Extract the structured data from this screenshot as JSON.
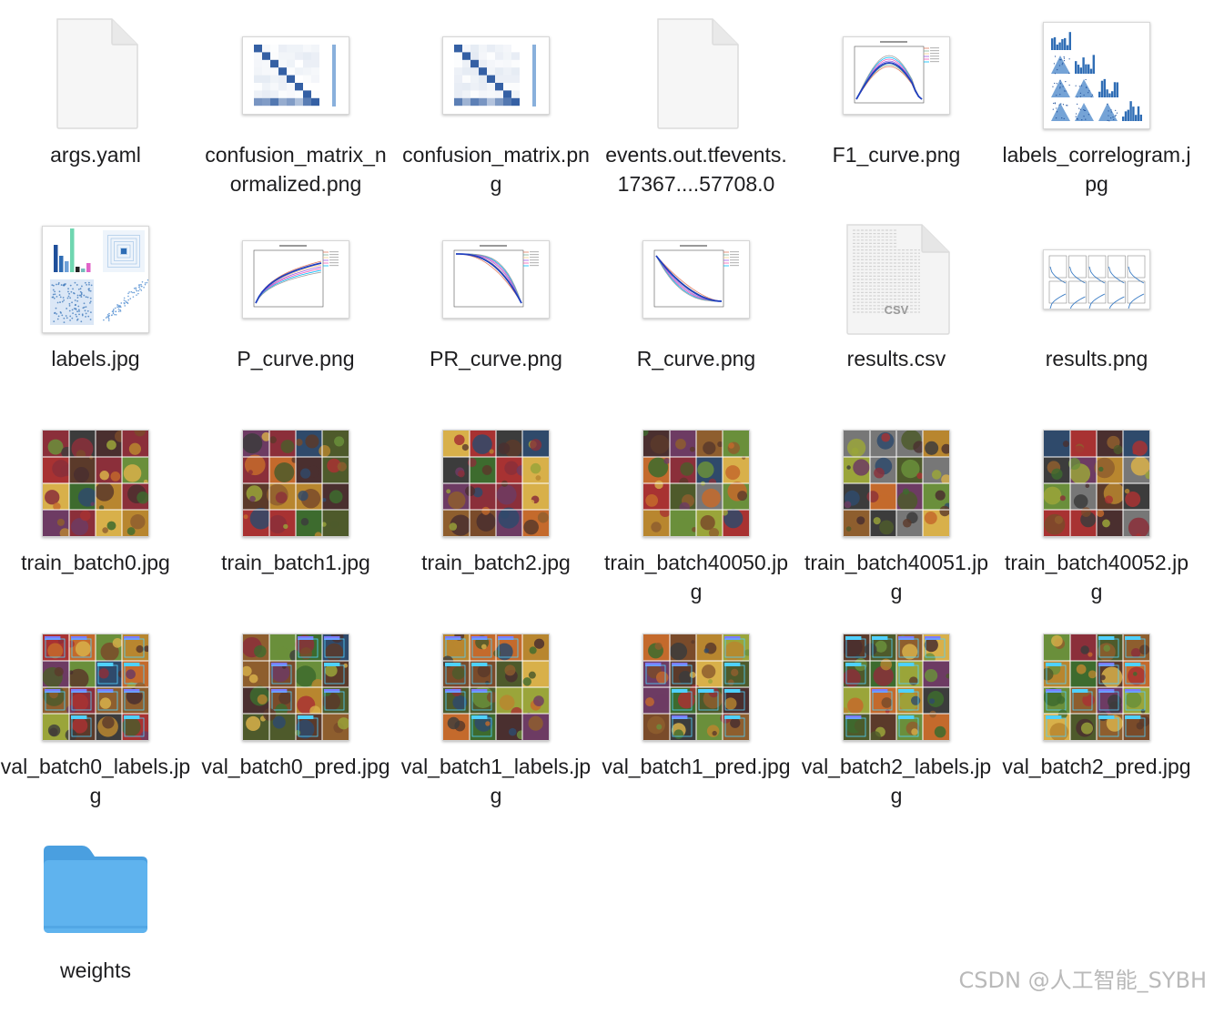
{
  "files": [
    {
      "name": "args.yaml",
      "kind": "document",
      "icon": "generic-document-icon"
    },
    {
      "name": "confusion_matrix_normalized.png",
      "kind": "confusion",
      "icon": "confusion-matrix-thumbnail"
    },
    {
      "name": "confusion_matrix.png",
      "kind": "confusion",
      "icon": "confusion-matrix-thumbnail"
    },
    {
      "name": "events.out.tfevents.17367....57708.0",
      "kind": "document",
      "icon": "generic-document-icon"
    },
    {
      "name": "F1_curve.png",
      "kind": "curve",
      "icon": "f1-curve-thumbnail"
    },
    {
      "name": "labels_correlogram.jpg",
      "kind": "correlogram",
      "icon": "correlogram-thumbnail"
    },
    {
      "name": "labels.jpg",
      "kind": "labels",
      "icon": "labels-thumbnail"
    },
    {
      "name": "P_curve.png",
      "kind": "curve",
      "icon": "p-curve-thumbnail"
    },
    {
      "name": "PR_curve.png",
      "kind": "curve",
      "icon": "pr-curve-thumbnail"
    },
    {
      "name": "R_curve.png",
      "kind": "curve",
      "icon": "r-curve-thumbnail"
    },
    {
      "name": "results.csv",
      "kind": "csv",
      "icon": "csv-document-icon",
      "badge": "CSV"
    },
    {
      "name": "results.png",
      "kind": "results",
      "icon": "results-thumbnail"
    },
    {
      "name": "train_batch0.jpg",
      "kind": "batch",
      "icon": "image-grid-thumbnail"
    },
    {
      "name": "train_batch1.jpg",
      "kind": "batch",
      "icon": "image-grid-thumbnail"
    },
    {
      "name": "train_batch2.jpg",
      "kind": "batch",
      "icon": "image-grid-thumbnail"
    },
    {
      "name": "train_batch40050.jpg",
      "kind": "batch",
      "icon": "image-grid-thumbnail"
    },
    {
      "name": "train_batch40051.jpg",
      "kind": "batch",
      "icon": "image-grid-thumbnail"
    },
    {
      "name": "train_batch40052.jpg",
      "kind": "batch",
      "icon": "image-grid-thumbnail"
    },
    {
      "name": "val_batch0_labels.jpg",
      "kind": "batch",
      "icon": "image-grid-thumbnail"
    },
    {
      "name": "val_batch0_pred.jpg",
      "kind": "batch",
      "icon": "image-grid-thumbnail"
    },
    {
      "name": "val_batch1_labels.jpg",
      "kind": "batch",
      "icon": "image-grid-thumbnail"
    },
    {
      "name": "val_batch1_pred.jpg",
      "kind": "batch",
      "icon": "image-grid-thumbnail"
    },
    {
      "name": "val_batch2_labels.jpg",
      "kind": "batch",
      "icon": "image-grid-thumbnail"
    },
    {
      "name": "val_batch2_pred.jpg",
      "kind": "batch",
      "icon": "image-grid-thumbnail"
    },
    {
      "name": "weights",
      "kind": "folder",
      "icon": "folder-icon"
    }
  ],
  "watermark": "CSDN @人工智能_SYBH",
  "colors": {
    "folder": "#5fb3ee",
    "folder_tab": "#4a9fe0",
    "chart_blue": "#3a7cc5",
    "matrix_dark": "#1f4f9a"
  }
}
